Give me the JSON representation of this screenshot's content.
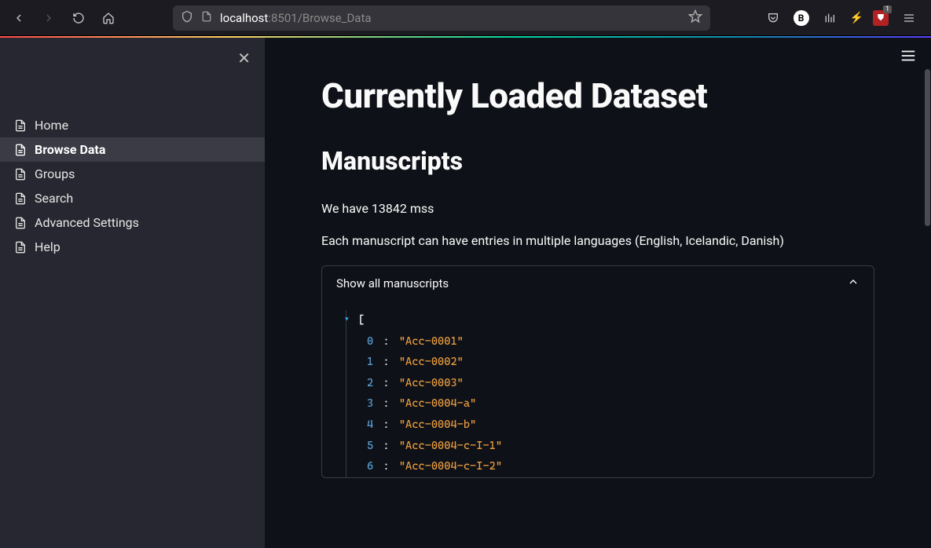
{
  "browser": {
    "url_host": "localhost",
    "url_port": ":8501",
    "url_path": "/Browse_Data",
    "badge_letter": "B",
    "ublock_count": "1"
  },
  "sidebar": {
    "items": [
      {
        "label": "Home"
      },
      {
        "label": "Browse Data"
      },
      {
        "label": "Groups"
      },
      {
        "label": "Search"
      },
      {
        "label": "Advanced Settings"
      },
      {
        "label": "Help"
      }
    ],
    "active_index": 1
  },
  "main": {
    "title": "Currently Loaded Dataset",
    "section_title": "Manuscripts",
    "count_text": "We have 13842 mss",
    "lang_text": "Each manuscript can have entries in multiple languages (English, Icelandic, Danish)",
    "expander_label": "Show all manuscripts",
    "manuscripts": [
      "Acc-0001",
      "Acc-0002",
      "Acc-0003",
      "Acc-0004-a",
      "Acc-0004-b",
      "Acc-0004-c-I-1",
      "Acc-0004-c-I-2"
    ]
  }
}
